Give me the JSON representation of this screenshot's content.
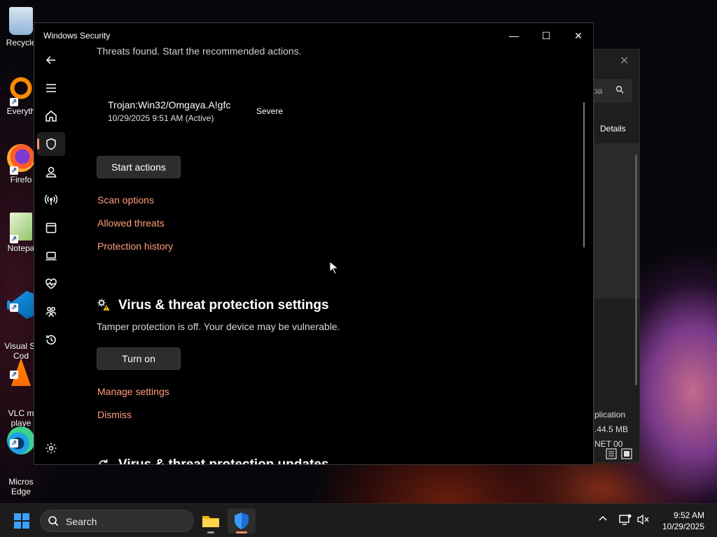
{
  "desktop": {
    "icons": [
      {
        "label": "Recycle",
        "icon": "recycle-bin-icon"
      },
      {
        "label": "Everyth",
        "icon": "everything-search-icon"
      },
      {
        "label": "Firefo",
        "icon": "firefox-icon"
      },
      {
        "label": "Notepa",
        "icon": "notepad-plus-plus-icon"
      },
      {
        "label": "Visual St\nCod",
        "icon": "vscode-icon"
      },
      {
        "label": "VLC m\nplaye",
        "icon": "vlc-icon"
      },
      {
        "label": "Micros\nEdge",
        "icon": "edge-icon"
      }
    ]
  },
  "background_window": {
    "search_text": "pa",
    "details_label": "Details",
    "labels": [
      "plication",
      ".44.5 MB",
      "NET 00"
    ]
  },
  "window": {
    "title": "Windows Security",
    "controls": {
      "minimize": "—",
      "maximize": "☐",
      "close": "✕"
    }
  },
  "nav": {
    "items": [
      "back-arrow-icon",
      "hamburger-menu-icon",
      "home-icon",
      "shield-icon",
      "person-icon",
      "wifi-signal-icon",
      "app-browser-icon",
      "laptop-icon",
      "heart-pulse-icon",
      "family-icon",
      "history-icon",
      "settings-gear-icon"
    ],
    "active_index": 3
  },
  "threats": {
    "header": "Threats found. Start the recommended actions.",
    "item": {
      "name": "Trojan:Win32/Omgaya.A!gfc",
      "meta": "10/29/2025 9:51 AM (Active)",
      "severity": "Severe"
    },
    "start_button": "Start actions",
    "links": [
      "Scan options",
      "Allowed threats",
      "Protection history"
    ]
  },
  "settings_section": {
    "title": "Virus & threat protection settings",
    "message": "Tamper protection is off. Your device may be vulnerable.",
    "button": "Turn on",
    "links": [
      "Manage settings",
      "Dismiss"
    ]
  },
  "updates_section": {
    "title": "Virus & threat protection updates"
  },
  "taskbar": {
    "search_label": "Search",
    "time": "9:52 AM",
    "date": "10/29/2025"
  },
  "colors": {
    "accent_link": "#ff9e7d",
    "accent_indicator": "#ff8c70",
    "window_bg": "#000000",
    "taskbar_bg": "#1c1c1c"
  }
}
